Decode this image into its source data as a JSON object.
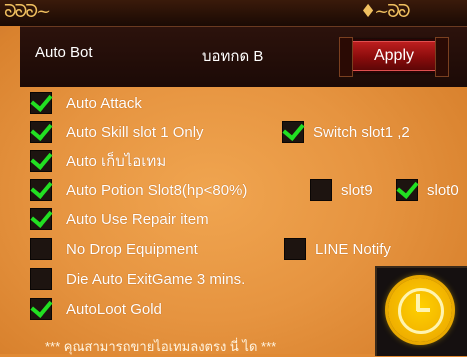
{
  "header": {
    "title": "Auto Bot",
    "hotkey_text": "บอทกด B",
    "apply_label": "Apply"
  },
  "options": [
    {
      "label": "Auto Attack",
      "checked": true
    },
    {
      "label": "Auto Skill slot 1 Only",
      "checked": true
    },
    {
      "label": "Auto เก็บไอเทม",
      "checked": true
    },
    {
      "label": "Auto Potion Slot8(hp<80%)",
      "checked": true
    },
    {
      "label": "Auto Use Repair item",
      "checked": true
    },
    {
      "label": "No Drop Equipment",
      "checked": false
    },
    {
      "label": "Die Auto ExitGame 3 mins.",
      "checked": false
    },
    {
      "label": "AutoLoot Gold",
      "checked": true
    }
  ],
  "extra_options": {
    "switch_slot": {
      "label": "Switch slot1 ,2",
      "checked": true
    },
    "slot9": {
      "label": "slot9",
      "checked": false
    },
    "slot0": {
      "label": "slot0",
      "checked": true
    },
    "line_notify": {
      "label": "LINE Notify",
      "checked": false
    }
  },
  "footer_note": "*** คุณสามารถขายไอเทมลงตรง นี่ ได ***",
  "icons": {
    "clock": "clock-icon",
    "ornament": "ornament-icon"
  },
  "colors": {
    "panel": "#e08a34",
    "checkbox": "#1d1410",
    "check": "#22e022",
    "apply": "#a01010",
    "clock": "#f0b000"
  }
}
